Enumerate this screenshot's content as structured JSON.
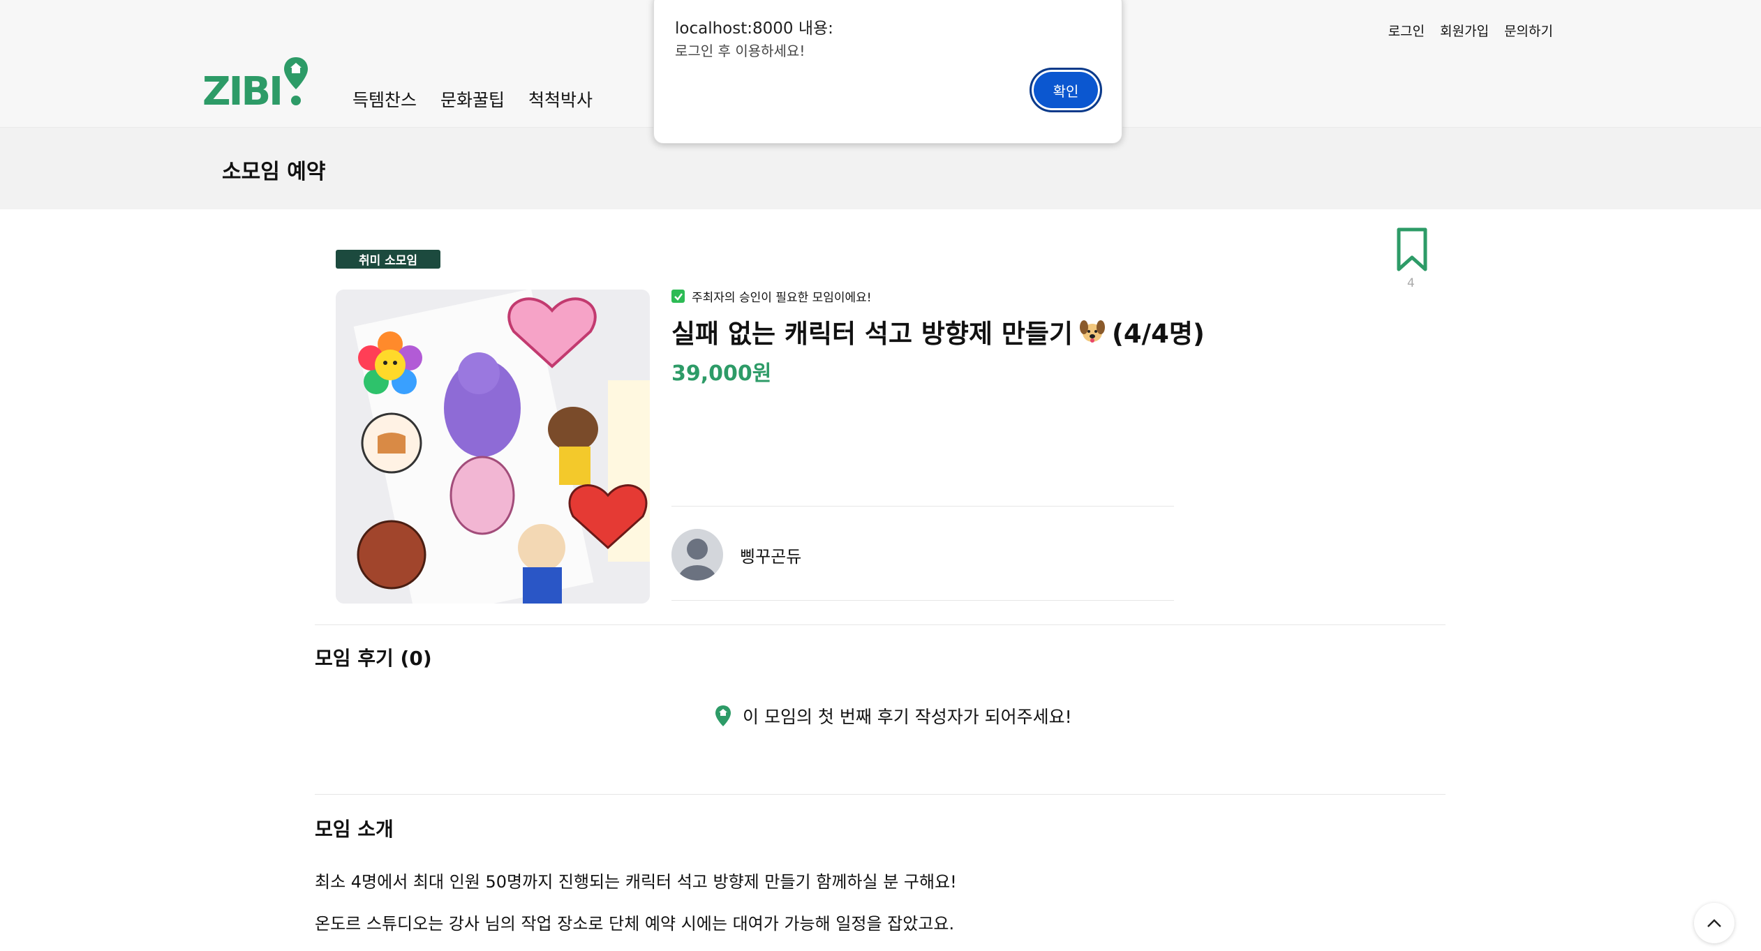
{
  "header": {
    "top_links": {
      "login": "로그인",
      "signup": "회원가입",
      "contact": "문의하기"
    },
    "logo_text": "ZIBI",
    "nav": {
      "item1": "득템찬스",
      "item2": "문화꿀팁",
      "item3": "척척박사"
    },
    "page_title": "소모임 예약"
  },
  "dialog": {
    "title": "localhost:8000 내용:",
    "message": "로그인 후 이용하세요!",
    "ok_label": "확인"
  },
  "meeting": {
    "category": "취미 소모임",
    "bookmark_count": "4",
    "approval_notice": "주최자의 승인이 필요한 모임이에요!",
    "title": "실패 없는 캐릭터 석고 방향제 만들기",
    "capacity": "(4/4명)",
    "price": "39,000원",
    "host_name": "삥꾸곤듀"
  },
  "reviews": {
    "heading": "모임 후기 (0)",
    "empty_message": "이 모임의 첫 번째 후기 작성자가 되어주세요!"
  },
  "intro": {
    "heading": "모임 소개",
    "line1": "최소 4명에서 최대 인원 50명까지 진행되는 캐릭터 석고 방향제 만들기 함께하실 분 구해요!",
    "line2": "온도르 스튜디오는 강사 님의 작업 장소로 단체 예약 시에는 대여가 가능해 일정을 잡았고요."
  },
  "colors": {
    "brand": "#2d9b67",
    "badge": "#1c4a3e",
    "dialog_button": "#0b57d0"
  }
}
